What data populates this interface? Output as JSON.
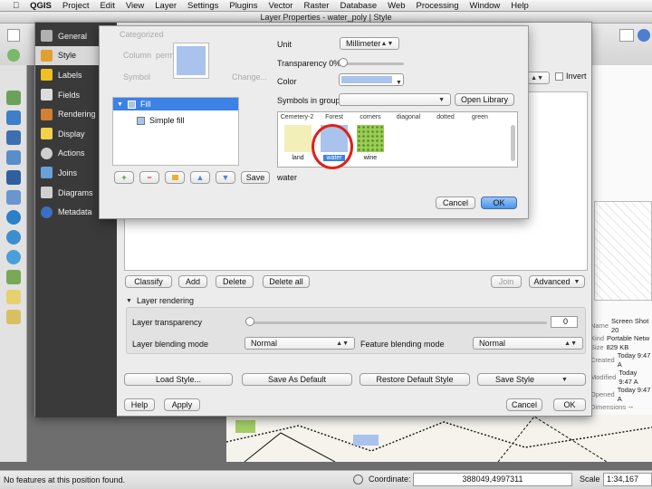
{
  "menubar": {
    "items": [
      "QGIS",
      "Project",
      "Edit",
      "View",
      "Layer",
      "Settings",
      "Plugins",
      "Vector",
      "Raster",
      "Database",
      "Web",
      "Processing",
      "Window",
      "Help"
    ]
  },
  "window": {
    "title": "Layer Properties - water_poly | Style"
  },
  "sidebar": {
    "items": [
      {
        "label": "General",
        "icon": "wrench-icon",
        "color": "#b0b0b0"
      },
      {
        "label": "Style",
        "icon": "paintbrush-icon",
        "color": "#e0a030"
      },
      {
        "label": "Labels",
        "icon": "abc-icon",
        "color": "#f0c020"
      },
      {
        "label": "Fields",
        "icon": "table-icon",
        "color": "#dcdcdc"
      },
      {
        "label": "Rendering",
        "icon": "brush-icon",
        "color": "#d08030"
      },
      {
        "label": "Display",
        "icon": "speech-bubble-icon",
        "color": "#f2d24a"
      },
      {
        "label": "Actions",
        "icon": "gear-icon",
        "color": "#cfcfcf"
      },
      {
        "label": "Joins",
        "icon": "join-icon",
        "color": "#6aa0d8"
      },
      {
        "label": "Diagrams",
        "icon": "diagram-icon",
        "color": "#d0d0d0"
      },
      {
        "label": "Metadata",
        "icon": "info-icon",
        "color": "#3b6fc2"
      }
    ]
  },
  "background_ghost": {
    "categorized": "Categorized",
    "column": "Column",
    "column_value": "permanency",
    "symbol": "Symbol",
    "change": "Change...",
    "color_ramp": "Invert"
  },
  "symbol_panel": {
    "tree": [
      {
        "label": "Fill",
        "selected": true
      },
      {
        "label": "Simple fill",
        "selected": false
      }
    ],
    "save_label": "Save",
    "unit_label": "Unit",
    "unit_value": "Millimeter",
    "transparency_label": "Transparency 0%",
    "color_label": "Color",
    "color_value": "#a9c3ec",
    "symbols_in_group_label": "Symbols in group",
    "open_library": "Open Library",
    "top_row": [
      "Cemetery-2",
      "Forest",
      "corners",
      "diagonal",
      "dotted",
      "green"
    ],
    "symbols": [
      {
        "name": "land",
        "color": "#f2f0b8"
      },
      {
        "name": "water",
        "color": "#a9c3ec",
        "selected": true
      },
      {
        "name": "wine",
        "color": "#9ccc55"
      }
    ],
    "selected_name": "water",
    "cancel": "Cancel",
    "ok": "OK"
  },
  "classify_bar": {
    "classify": "Classify",
    "add": "Add",
    "delete": "Delete",
    "delete_all": "Delete all",
    "join": "Join",
    "advanced": "Advanced"
  },
  "layer_rendering": {
    "title": "Layer rendering",
    "transparency_label": "Layer transparency",
    "transparency_value": "0",
    "blending_label": "Layer blending mode",
    "blending_value": "Normal",
    "feature_blending_label": "Feature blending mode",
    "feature_blending_value": "Normal"
  },
  "bottom_bar": {
    "load_style": "Load Style...",
    "save_default": "Save As Default",
    "restore_default": "Restore Default Style",
    "save_style": "Save Style"
  },
  "footer": {
    "help": "Help",
    "apply": "Apply",
    "cancel": "Cancel",
    "ok": "OK"
  },
  "info_panel": {
    "rows": [
      {
        "key": "Name",
        "value": "Screen Shot 20"
      },
      {
        "key": "Kind",
        "value": "Portable Netw"
      },
      {
        "key": "Size",
        "value": "829 KB"
      },
      {
        "key": "Created",
        "value": "Today 9:47 A"
      },
      {
        "key": "Modified",
        "value": "Today 9:47 A"
      },
      {
        "key": "Opened",
        "value": "Today 9:47 A"
      },
      {
        "key": "Dimensions",
        "value": "--"
      }
    ]
  },
  "statusbar": {
    "message": "No features at this position found.",
    "coordinate_label": "Coordinate:",
    "coordinate_value": "388049,4997311",
    "scale_label": "Scale",
    "scale_value": "1:34,167"
  },
  "colors": {
    "accent": "#3b82e4",
    "highlight_ring": "#e0201a"
  }
}
